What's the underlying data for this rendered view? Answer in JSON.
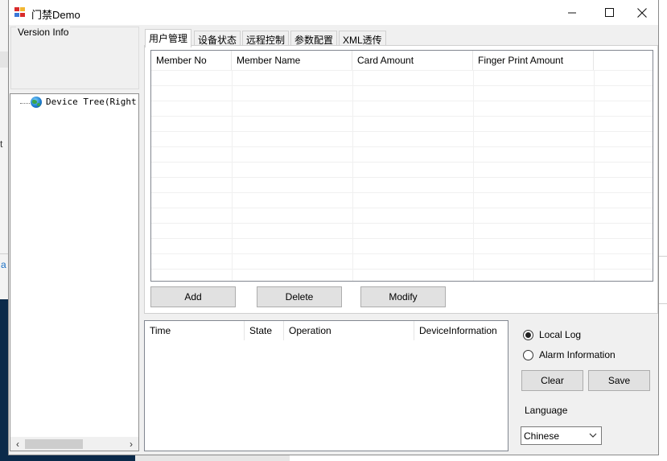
{
  "window": {
    "title": "门禁Demo",
    "controls": {
      "minimize": "—",
      "maximize": "☐",
      "close": "✕"
    }
  },
  "version_group": {
    "label": "Version Info"
  },
  "device_tree": {
    "root_label": "Device Tree(Right Click"
  },
  "tabs": [
    {
      "label": "用户管理",
      "active": true
    },
    {
      "label": "设备状态",
      "active": false
    },
    {
      "label": "远程控制",
      "active": false
    },
    {
      "label": "参数配置",
      "active": false
    },
    {
      "label": "XML透传",
      "active": false
    }
  ],
  "member_table": {
    "columns": [
      "Member No",
      "Member Name",
      "Card Amount",
      "Finger Print Amount",
      ""
    ],
    "rows": []
  },
  "buttons": {
    "add": "Add",
    "delete": "Delete",
    "modify": "Modify",
    "clear": "Clear",
    "save": "Save"
  },
  "log_table": {
    "columns": [
      "Time",
      "State",
      "Operation",
      "DeviceInformation"
    ],
    "rows": []
  },
  "log_options": {
    "local_log": {
      "label": "Local Log",
      "checked": true
    },
    "alarm_information": {
      "label": "Alarm Information",
      "checked": false
    }
  },
  "language": {
    "label": "Language",
    "selected": "Chinese"
  },
  "background": {
    "left_char_1": "t",
    "left_char_2": "a"
  },
  "colors": {
    "window_bg": "#f0f0f0",
    "list_border": "#828790",
    "button_bg": "#e1e1e1",
    "desktop_dark": "#0b2a4a"
  }
}
